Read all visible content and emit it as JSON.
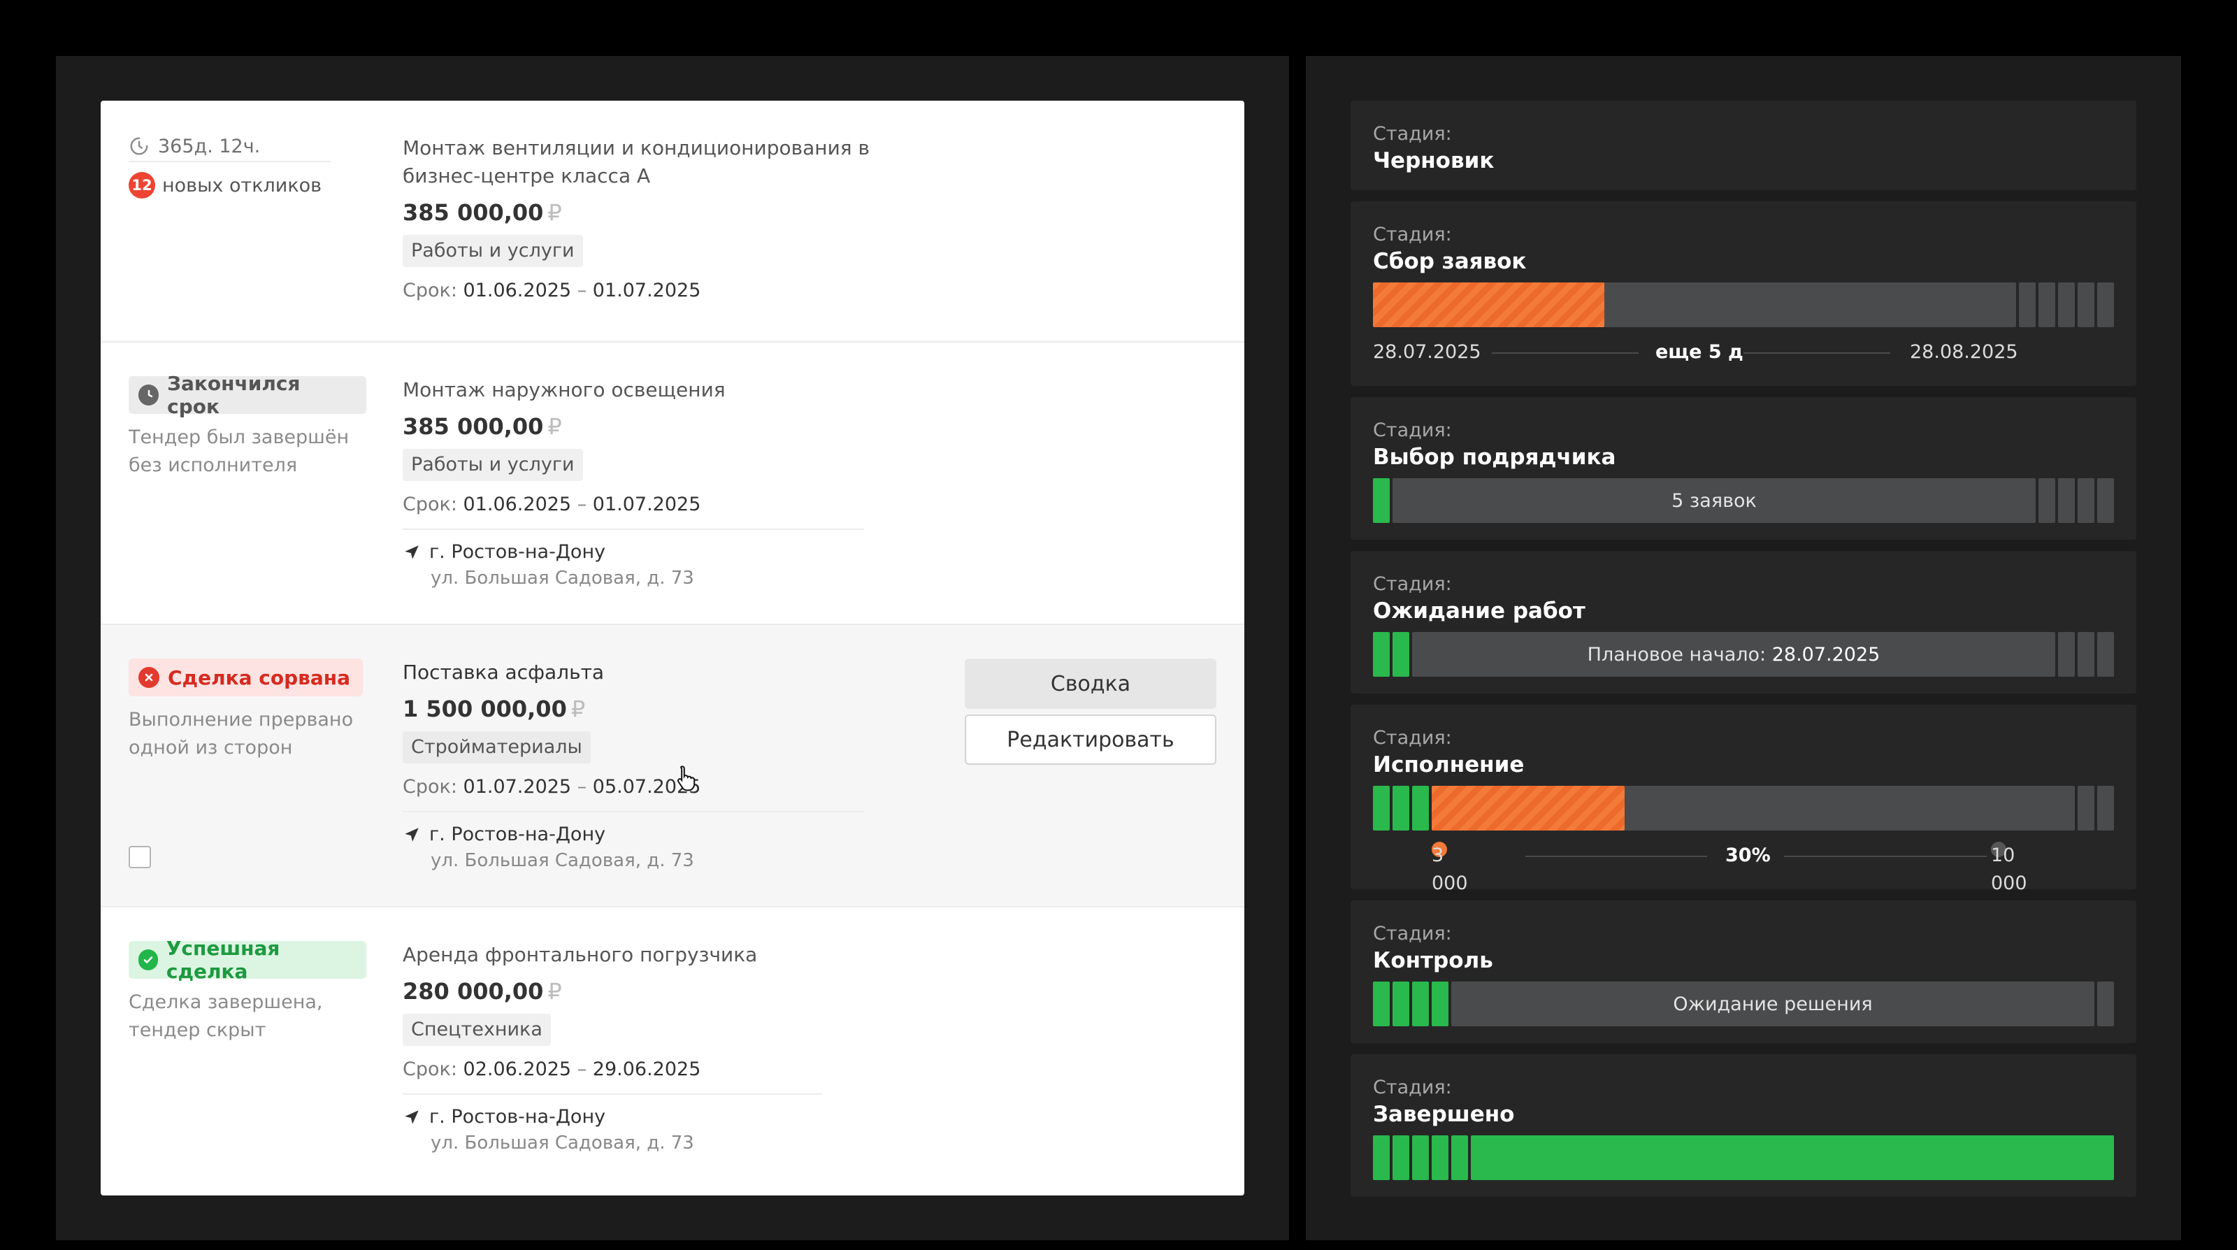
{
  "tenders": [
    {
      "timer": "365д. 12ч.",
      "responses_count": "12",
      "responses_label": "новых откликов",
      "title": "Монтаж вентиляции и кондиционирования в бизнес-центре класса А",
      "price": "385 000,00",
      "currency": "₽",
      "category": "Работы и услуги",
      "term_label": "Срок:",
      "term_start": "01.06.2025",
      "term_sep": "–",
      "term_end": "01.07.2025"
    },
    {
      "status": "Закончился срок",
      "note": "Тендер был завершён без исполнителя",
      "title": "Монтаж наружного освещения",
      "price": "385 000,00",
      "currency": "₽",
      "category": "Работы и услуги",
      "term_label": "Срок:",
      "term_start": "01.06.2025",
      "term_sep": "–",
      "term_end": "01.07.2025",
      "city": "г. Ростов-на-Дону",
      "street": "ул. Большая Садовая, д. 73"
    },
    {
      "status": "Сделка сорвана",
      "note": "Выполнение прервано одной из сторон",
      "title": "Поставка асфальта",
      "price": "1 500 000,00",
      "currency": "₽",
      "category": "Стройматериалы",
      "term_label": "Срок:",
      "term_start": "01.07.2025",
      "term_sep": "–",
      "term_end": "05.07.2025",
      "city": "г. Ростов-на-Дону",
      "street": "ул. Большая Садовая, д. 73",
      "summary_button": "Сводка",
      "edit_button": "Редактировать",
      "checked": false
    },
    {
      "status": "Успешная сделка",
      "note": "Сделка завершена, тендер скрыт",
      "title": "Аренда фронтального погрузчика",
      "price": "280 000,00",
      "currency": "₽",
      "category": "Спецтехника",
      "term_label": "Срок:",
      "term_start": "02.06.2025",
      "term_sep": "–",
      "term_end": "29.06.2025",
      "city": "г. Ростов-на-Дону",
      "street": "ул. Большая Садовая, д. 73"
    }
  ],
  "stages": [
    {
      "label": "Стадия:",
      "name": "Черновик"
    },
    {
      "label": "Стадия:",
      "name": "Сбор заявок",
      "start_date": "28.07.2025",
      "remaining": "еще 5 д",
      "end_date": "28.08.2025",
      "progress_fraction": 0.36
    },
    {
      "label": "Стадия:",
      "name": "Выбор подрядчика",
      "bar_text": "5 заявок"
    },
    {
      "label": "Стадия:",
      "name": "Ожидание работ",
      "bar_prefix": "Плановое начало:",
      "bar_value": "28.07.2025"
    },
    {
      "label": "Стадия:",
      "name": "Исполнение",
      "done_value": "3 000",
      "percent": "30%",
      "total_value": "10 000",
      "progress_fraction": 0.3
    },
    {
      "label": "Стадия:",
      "name": "Контроль",
      "bar_text": "Ожидание решения"
    },
    {
      "label": "Стадия:",
      "name": "Завершено"
    }
  ],
  "colors": {
    "orange": "#f47a3a",
    "green": "#29b94c",
    "track": "#4a4b4c",
    "danger": "#e23a2e"
  }
}
